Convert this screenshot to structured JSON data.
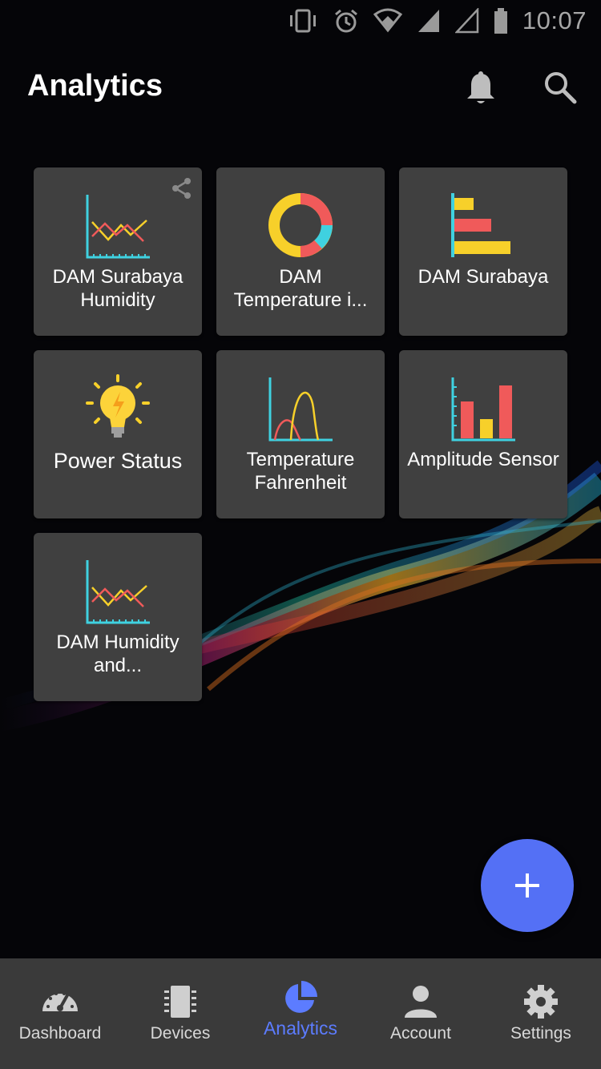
{
  "status_bar": {
    "time": "10:07"
  },
  "app_bar": {
    "title": "Analytics"
  },
  "tiles": [
    {
      "label": "DAM Surabaya Humidity",
      "icon": "line-chart-icon"
    },
    {
      "label": "DAM Temperature i...",
      "icon": "donut-chart-icon"
    },
    {
      "label": "DAM Surabaya",
      "icon": "horizontal-bar-chart-icon"
    },
    {
      "label": "Power Status",
      "icon": "lightbulb-icon"
    },
    {
      "label": "Temperature Fahrenheit",
      "icon": "area-curve-chart-icon"
    },
    {
      "label": "Amplitude Sensor",
      "icon": "bar-chart-icon"
    },
    {
      "label": "DAM Humidity and...",
      "icon": "line-chart-icon"
    }
  ],
  "fab": {
    "icon": "plus-icon"
  },
  "bottom_nav": [
    {
      "label": "Dashboard",
      "icon": "speedometer-icon"
    },
    {
      "label": "Devices",
      "icon": "chip-icon"
    },
    {
      "label": "Analytics",
      "icon": "pie-chart-icon",
      "active": true
    },
    {
      "label": "Account",
      "icon": "person-icon"
    },
    {
      "label": "Settings",
      "icon": "gear-icon"
    }
  ],
  "colors": {
    "accent": "#5470f5",
    "active_nav": "#5c7cff",
    "tile_bg": "#404040",
    "nav_bg": "#3a3a3a",
    "chart_cyan": "#3fd1e0",
    "chart_red": "#f05a5a",
    "chart_yellow": "#f7d02a"
  }
}
